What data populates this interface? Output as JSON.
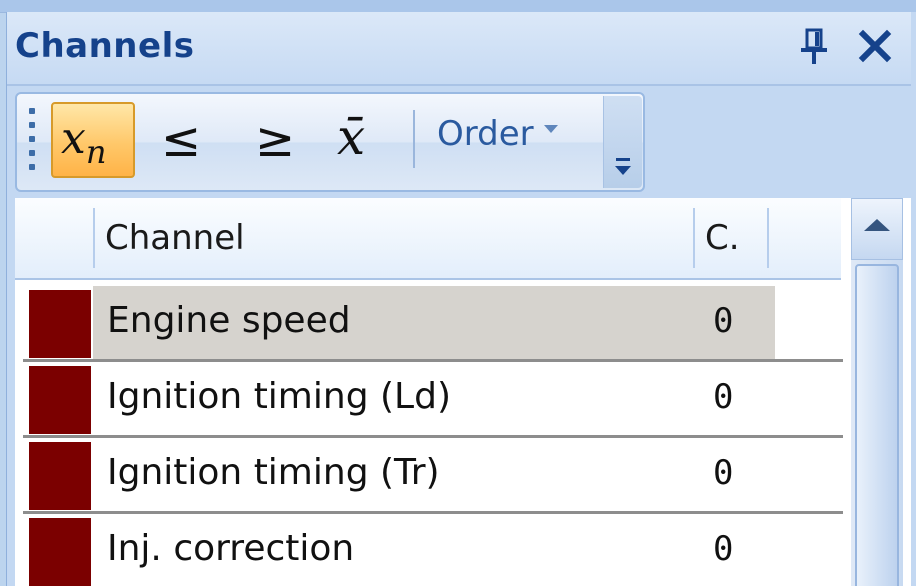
{
  "panel": {
    "title": "Channels"
  },
  "toolbar": {
    "buttons": [
      {
        "icon": "x-sub-n-icon",
        "label": "x",
        "sub": "n",
        "active": true
      },
      {
        "icon": "less-or-equal-icon",
        "label": "≤"
      },
      {
        "icon": "greater-or-equal-icon",
        "label": "≥"
      },
      {
        "icon": "x-bar-mean-icon",
        "label": "x̄"
      }
    ],
    "order_label": "Order"
  },
  "grid": {
    "columns": [
      "Channel",
      "C."
    ],
    "rows": [
      {
        "name": "Engine speed",
        "value": "0",
        "color": "#7b0000",
        "selected": true
      },
      {
        "name": "Ignition timing (Ld)",
        "value": "0",
        "color": "#7b0000"
      },
      {
        "name": "Ignition timing (Tr)",
        "value": "0",
        "color": "#7b0000"
      },
      {
        "name": "Inj. correction",
        "value": "0",
        "color": "#7b0000"
      }
    ]
  },
  "colors": {
    "title_text": "#15428b",
    "channel_swatch": "#7b0000",
    "selected_row": "#d6d3ce",
    "active_button": "#ffc86a"
  }
}
